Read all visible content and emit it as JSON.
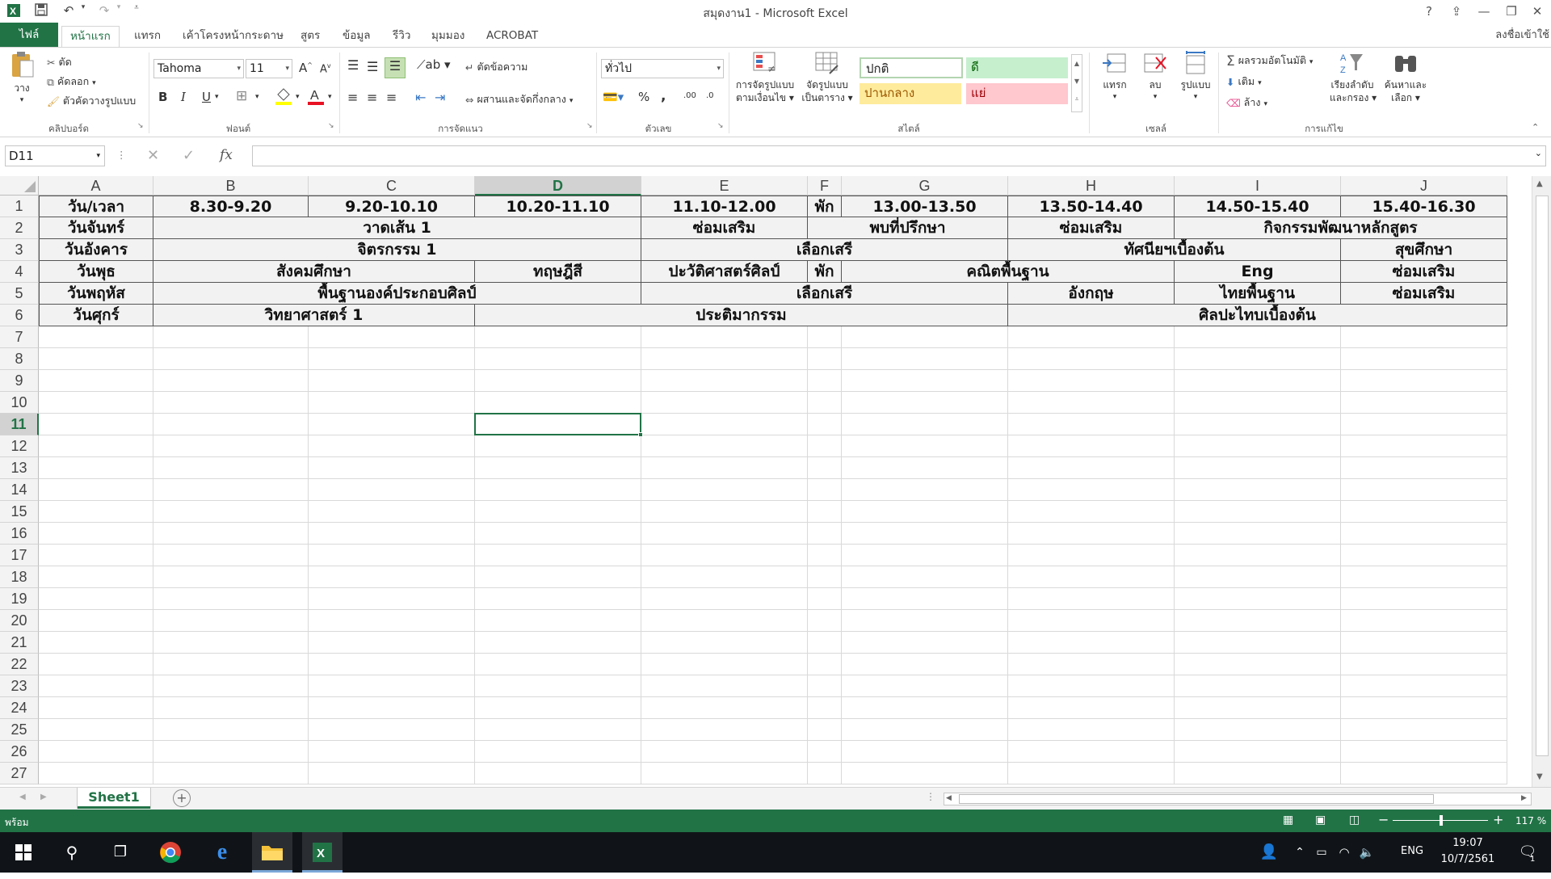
{
  "window": {
    "title": "สมุดงาน1 - Microsoft Excel",
    "help": "?",
    "icons": [
      "excel-logo",
      "save-icon",
      "undo-icon",
      "redo-icon",
      "customize-qat-icon"
    ]
  },
  "ribbon_tabs": [
    "ไฟล์",
    "หน้าแรก",
    "แทรก",
    "เค้าโครงหน้ากระดาษ",
    "สูตร",
    "ข้อมูล",
    "รีวิว",
    "มุมมอง",
    "ACROBAT"
  ],
  "signin": "ลงชื่อเข้าใช้",
  "clipboard": {
    "paste": "วาง",
    "cut": "ตัด",
    "copy": "คัดลอก",
    "format_painter": "ตัวคัดวางรูปแบบ",
    "label": "คลิปบอร์ด"
  },
  "font": {
    "name": "Tahoma",
    "size": "11",
    "bold": "B",
    "italic": "I",
    "underline": "U",
    "label": "ฟอนต์"
  },
  "alignment": {
    "wrap": "ตัดข้อความ",
    "merge": "ผสานและจัดกึ่งกลาง",
    "label": "การจัดแนว"
  },
  "number": {
    "format": "ทั่วไป",
    "percent": "%",
    "comma": ",",
    "inc_decimal": ".00",
    "dec_decimal": ".0",
    "label": "ตัวเลข"
  },
  "styles": {
    "conditional": [
      "การจัดรูปแบบ",
      "ตามเงื่อนไข"
    ],
    "as_table": [
      "จัดรูปแบบ",
      "เป็นตาราง"
    ],
    "normal": "ปกติ",
    "good": "ดี",
    "neutral": "ปานกลาง",
    "bad": "แย่",
    "label": "สไตล์"
  },
  "cells": {
    "insert": "แทรก",
    "delete": "ลบ",
    "format": "รูปแบบ",
    "label": "เซลล์"
  },
  "editing": {
    "autosum": "ผลรวมอัตโนมัติ",
    "fill": "เติม",
    "clear": "ล้าง",
    "sort": [
      "เรียงลำดับ",
      "และกรอง"
    ],
    "find": [
      "ค้นหาและ",
      "เลือก"
    ],
    "label": "การแก้ไข"
  },
  "formula_bar": {
    "name_box": "D11",
    "fx": "fx",
    "content": ""
  },
  "columns": [
    "A",
    "B",
    "C",
    "D",
    "E",
    "F",
    "G",
    "H",
    "I",
    "J"
  ],
  "rows": [
    "1",
    "2",
    "3",
    "4",
    "5",
    "6",
    "7",
    "8",
    "9",
    "10",
    "11",
    "12",
    "13",
    "14",
    "15",
    "16",
    "17",
    "18",
    "19",
    "20",
    "21",
    "22",
    "23",
    "24",
    "25",
    "26",
    "27"
  ],
  "selected": {
    "col": "D",
    "row": "11"
  },
  "cells_data": [
    {
      "r": 1,
      "c1": "A",
      "c2": "A",
      "text": "วัน/เวลา"
    },
    {
      "r": 1,
      "c1": "B",
      "c2": "B",
      "text": "8.30-9.20"
    },
    {
      "r": 1,
      "c1": "C",
      "c2": "C",
      "text": "9.20-10.10"
    },
    {
      "r": 1,
      "c1": "D",
      "c2": "D",
      "text": "10.20-11.10"
    },
    {
      "r": 1,
      "c1": "E",
      "c2": "E",
      "text": "11.10-12.00"
    },
    {
      "r": 1,
      "c1": "F",
      "c2": "F",
      "text": "พัก"
    },
    {
      "r": 1,
      "c1": "G",
      "c2": "G",
      "text": "13.00-13.50"
    },
    {
      "r": 1,
      "c1": "H",
      "c2": "H",
      "text": "13.50-14.40"
    },
    {
      "r": 1,
      "c1": "I",
      "c2": "I",
      "text": "14.50-15.40"
    },
    {
      "r": 1,
      "c1": "J",
      "c2": "J",
      "text": "15.40-16.30"
    },
    {
      "r": 2,
      "c1": "A",
      "c2": "A",
      "text": "วันจันทร์"
    },
    {
      "r": 2,
      "c1": "B",
      "c2": "D",
      "text": "วาดเส้น 1"
    },
    {
      "r": 2,
      "c1": "E",
      "c2": "E",
      "text": "ซ่อมเสริม"
    },
    {
      "r": 2,
      "c1": "F",
      "c2": "G",
      "text": "พบที่ปรึกษา"
    },
    {
      "r": 2,
      "c1": "H",
      "c2": "H",
      "text": "ซ่อมเสริม"
    },
    {
      "r": 2,
      "c1": "I",
      "c2": "J",
      "text": "กิจกรรมพัฒนาหลักสูตร"
    },
    {
      "r": 3,
      "c1": "A",
      "c2": "A",
      "text": "วันอังคาร"
    },
    {
      "r": 3,
      "c1": "B",
      "c2": "D",
      "text": "จิตรกรรม 1"
    },
    {
      "r": 3,
      "c1": "E",
      "c2": "G",
      "text": "เลือกเสรี"
    },
    {
      "r": 3,
      "c1": "H",
      "c2": "I",
      "text": "ทัศนียฯเบื้องต้น"
    },
    {
      "r": 3,
      "c1": "J",
      "c2": "J",
      "text": "สุขศึกษา"
    },
    {
      "r": 4,
      "c1": "A",
      "c2": "A",
      "text": "วันพุธ"
    },
    {
      "r": 4,
      "c1": "B",
      "c2": "C",
      "text": "สังคมศึกษา"
    },
    {
      "r": 4,
      "c1": "D",
      "c2": "D",
      "text": "ทฤษฎีสี"
    },
    {
      "r": 4,
      "c1": "E",
      "c2": "E",
      "text": "ปะวัติศาสตร์ศิลป์"
    },
    {
      "r": 4,
      "c1": "F",
      "c2": "F",
      "text": "พัก"
    },
    {
      "r": 4,
      "c1": "G",
      "c2": "H",
      "text": "คณิตพื้นฐาน"
    },
    {
      "r": 4,
      "c1": "I",
      "c2": "I",
      "text": "Eng"
    },
    {
      "r": 4,
      "c1": "J",
      "c2": "J",
      "text": "ซ่อมเสริม"
    },
    {
      "r": 5,
      "c1": "A",
      "c2": "A",
      "text": "วันพฤหัส"
    },
    {
      "r": 5,
      "c1": "B",
      "c2": "D",
      "text": "พื้นฐานองค์ประกอบศิลป์"
    },
    {
      "r": 5,
      "c1": "E",
      "c2": "G",
      "text": "เลือกเสรี"
    },
    {
      "r": 5,
      "c1": "H",
      "c2": "H",
      "text": "อังกฤษ"
    },
    {
      "r": 5,
      "c1": "I",
      "c2": "I",
      "text": "ไทยพื้นฐาน"
    },
    {
      "r": 5,
      "c1": "J",
      "c2": "J",
      "text": "ซ่อมเสริม"
    },
    {
      "r": 6,
      "c1": "A",
      "c2": "A",
      "text": "วันศุกร์"
    },
    {
      "r": 6,
      "c1": "B",
      "c2": "C",
      "text": "วิทยาศาสตร์ 1"
    },
    {
      "r": 6,
      "c1": "D",
      "c2": "G",
      "text": "ประติมากรรม"
    },
    {
      "r": 6,
      "c1": "H",
      "c2": "J",
      "text": "ศิลปะไทบเบื้องต้น"
    }
  ],
  "sheet_tabs": [
    "Sheet1"
  ],
  "status": {
    "ready": "พร้อม",
    "zoom": "117 %"
  },
  "taskbar": {
    "lang": "ENG",
    "time": "19:07",
    "date": "10/7/2561",
    "notifications": "1"
  },
  "colors": {
    "excel_green": "#217346",
    "cell_fill": "#f2f2f2",
    "good_fill": "#c6efce",
    "neutral_fill": "#ffeb9c",
    "bad_fill": "#ffc7ce"
  }
}
